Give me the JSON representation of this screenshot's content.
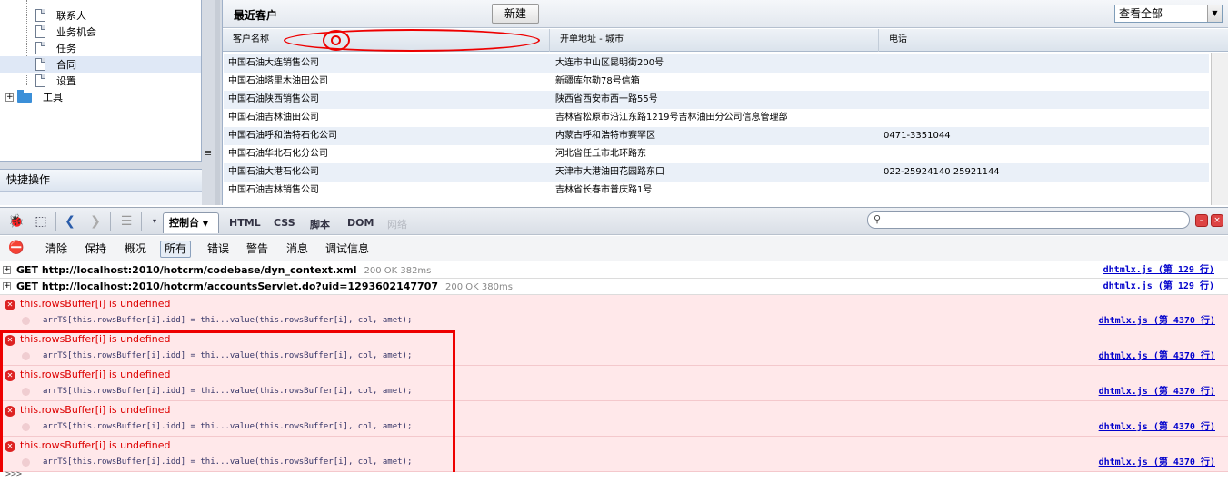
{
  "tree": {
    "items": [
      "联系人",
      "业务机会",
      "任务",
      "合同",
      "设置"
    ],
    "tools_folder": "工具",
    "quick_actions": "快捷操作"
  },
  "grid": {
    "title": "最近客户",
    "new_button": "新建",
    "view_select": "查看全部",
    "columns": [
      "客户名称",
      "开单地址 - 城市",
      "电话"
    ],
    "rows": [
      {
        "name": "中国石油大连销售公司",
        "address": "大连市中山区昆明街200号",
        "phone": ""
      },
      {
        "name": "中国石油塔里木油田公司",
        "address": "新疆库尔勒78号信箱",
        "phone": ""
      },
      {
        "name": "中国石油陕西销售公司",
        "address": "陕西省西安市西一路55号",
        "phone": ""
      },
      {
        "name": "中国石油吉林油田公司",
        "address": "吉林省松原市沿江东路1219号吉林油田分公司信息管理部",
        "phone": ""
      },
      {
        "name": "中国石油呼和浩特石化公司",
        "address": "内蒙古呼和浩特市赛罕区",
        "phone": "0471-3351044"
      },
      {
        "name": "中国石油华北石化分公司",
        "address": "河北省任丘市北环路东",
        "phone": ""
      },
      {
        "name": "中国石油大港石化公司",
        "address": "天津市大港油田花园路东口",
        "phone": "022-25924140 25921144"
      },
      {
        "name": "中国石油吉林销售公司",
        "address": "吉林省长春市普庆路1号",
        "phone": ""
      }
    ]
  },
  "firebug": {
    "tabs": {
      "console": "控制台",
      "html": "HTML",
      "css": "CSS",
      "script": "脚本",
      "dom": "DOM",
      "net": "网络"
    },
    "filters": [
      "清除",
      "保持",
      "概况",
      "所有",
      "错误",
      "警告",
      "消息",
      "调试信息"
    ],
    "requests": [
      {
        "text": "GET http://localhost:2010/hotcrm/codebase/dyn_context.xml",
        "status": "200 OK 382ms",
        "source": "dhtmlx.js (第 129 行)"
      },
      {
        "text": "GET http://localhost:2010/hotcrm/accountsServlet.do?uid=1293602147707",
        "status": "200 OK 380ms",
        "source": "dhtmlx.js (第 129 行)"
      }
    ],
    "errors": [
      {
        "message": "this.rowsBuffer[i] is undefined",
        "code": "arrTS[this.rowsBuffer[i].idd] = thi...value(this.rowsBuffer[i], col, amet);",
        "source": "dhtmlx.js (第 4370 行)"
      },
      {
        "message": "this.rowsBuffer[i] is undefined",
        "code": "arrTS[this.rowsBuffer[i].idd] = thi...value(this.rowsBuffer[i], col, amet);",
        "source": "dhtmlx.js (第 4370 行)"
      },
      {
        "message": "this.rowsBuffer[i] is undefined",
        "code": "arrTS[this.rowsBuffer[i].idd] = thi...value(this.rowsBuffer[i], col, amet);",
        "source": "dhtmlx.js (第 4370 行)"
      },
      {
        "message": "this.rowsBuffer[i] is undefined",
        "code": "arrTS[this.rowsBuffer[i].idd] = thi...value(this.rowsBuffer[i], col, amet);",
        "source": "dhtmlx.js (第 4370 行)"
      },
      {
        "message": "this.rowsBuffer[i] is undefined",
        "code": "arrTS[this.rowsBuffer[i].idd] = thi...value(this.rowsBuffer[i], col, amet);",
        "source": "dhtmlx.js (第 4370 行)"
      }
    ],
    "prompt": ">>>"
  },
  "annotation_color": "#e00000"
}
